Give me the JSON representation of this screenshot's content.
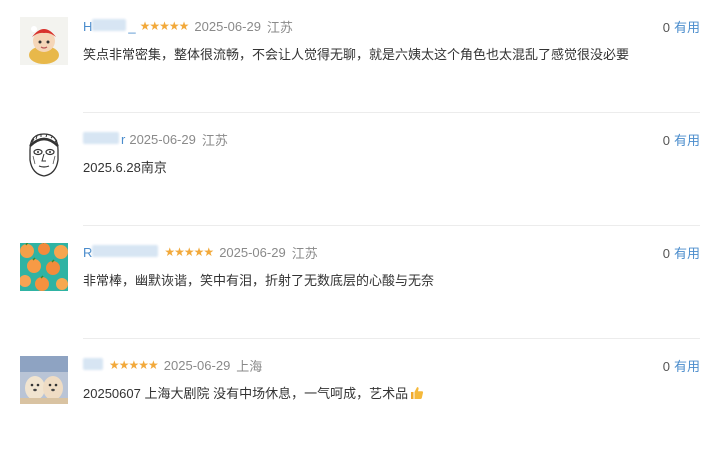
{
  "reviews": [
    {
      "username_visible": "H",
      "username_suffix": "_",
      "stars": "★★★★★",
      "date": "2025-06-29",
      "location": "江苏",
      "content": "笑点非常密集，整体很流畅，不会让人觉得无聊，就是六姨太这个角色也太混乱了感觉很没必要",
      "useful_count": "0",
      "useful_label": "有用"
    },
    {
      "username_visible": "",
      "username_suffix": "r",
      "stars": "",
      "date": "2025-06-29",
      "location": "江苏",
      "content": "2025.6.28南京",
      "useful_count": "0",
      "useful_label": "有用"
    },
    {
      "username_visible": "R",
      "username_suffix": "",
      "stars": "★★★★★",
      "date": "2025-06-29",
      "location": "江苏",
      "content": "非常棒，幽默诙谐，笑中有泪，折射了无数底层的心酸与无奈",
      "useful_count": "0",
      "useful_label": "有用"
    },
    {
      "username_visible": "",
      "username_suffix": "",
      "stars": "★★★★★",
      "date": "2025-06-29",
      "location": "上海",
      "content": "20250607 上海大剧院 没有中场休息，一气呵成，艺术品",
      "useful_count": "0",
      "useful_label": "有用"
    }
  ],
  "colors": {
    "username": "#4a8ccc",
    "star": "#f2a93b",
    "meta": "#8a8a8a",
    "content": "#333333",
    "useful_link": "#4a8ccc"
  },
  "icons": [
    "avatar-1-icon",
    "avatar-2-icon",
    "avatar-3-icon",
    "avatar-4-icon",
    "thumbs-up-icon"
  ]
}
